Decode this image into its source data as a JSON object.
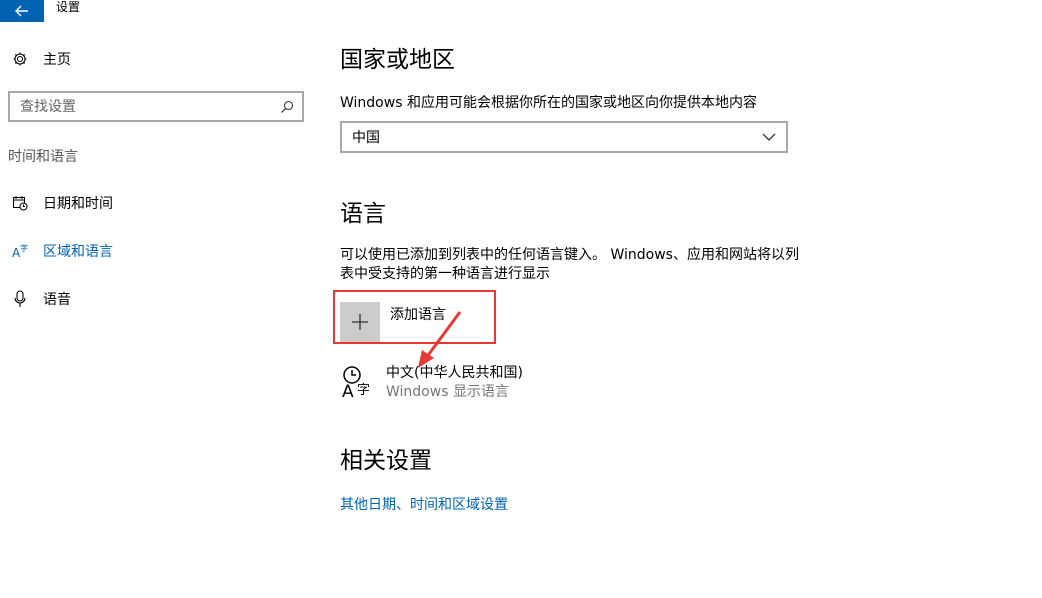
{
  "window": {
    "title": "设置",
    "back_icon": "back-arrow-icon",
    "accent_color": "#0063b1"
  },
  "sidebar": {
    "home": {
      "label": "主页",
      "icon": "gear-icon"
    },
    "search": {
      "placeholder": "查找设置",
      "icon": "search-icon"
    },
    "section_label": "时间和语言",
    "items": [
      {
        "label": "日期和时间",
        "icon": "calendar-clock-icon",
        "selected": false
      },
      {
        "label": "区域和语言",
        "icon": "region-language-icon",
        "selected": true
      },
      {
        "label": "语音",
        "icon": "microphone-icon",
        "selected": false
      }
    ]
  },
  "main": {
    "region": {
      "title": "国家或地区",
      "description": "Windows 和应用可能会根据你所在的国家或地区向你提供本地内容",
      "selected_value": "中国",
      "dropdown_icon": "chevron-down-icon"
    },
    "language": {
      "title": "语言",
      "description": "可以使用已添加到列表中的任何语言键入。 Windows、应用和网站将以列表中受支持的第一种语言进行显示",
      "add_button_label": "添加语言",
      "add_icon": "plus-icon",
      "items": [
        {
          "name": "中文(中华人民共和国)",
          "detail": "Windows 显示语言",
          "icon": "language-icon"
        }
      ]
    },
    "related": {
      "title": "相关设置",
      "link": "其他日期、时间和区域设置"
    }
  },
  "annotations": {
    "highlight_color": "#e53935"
  }
}
